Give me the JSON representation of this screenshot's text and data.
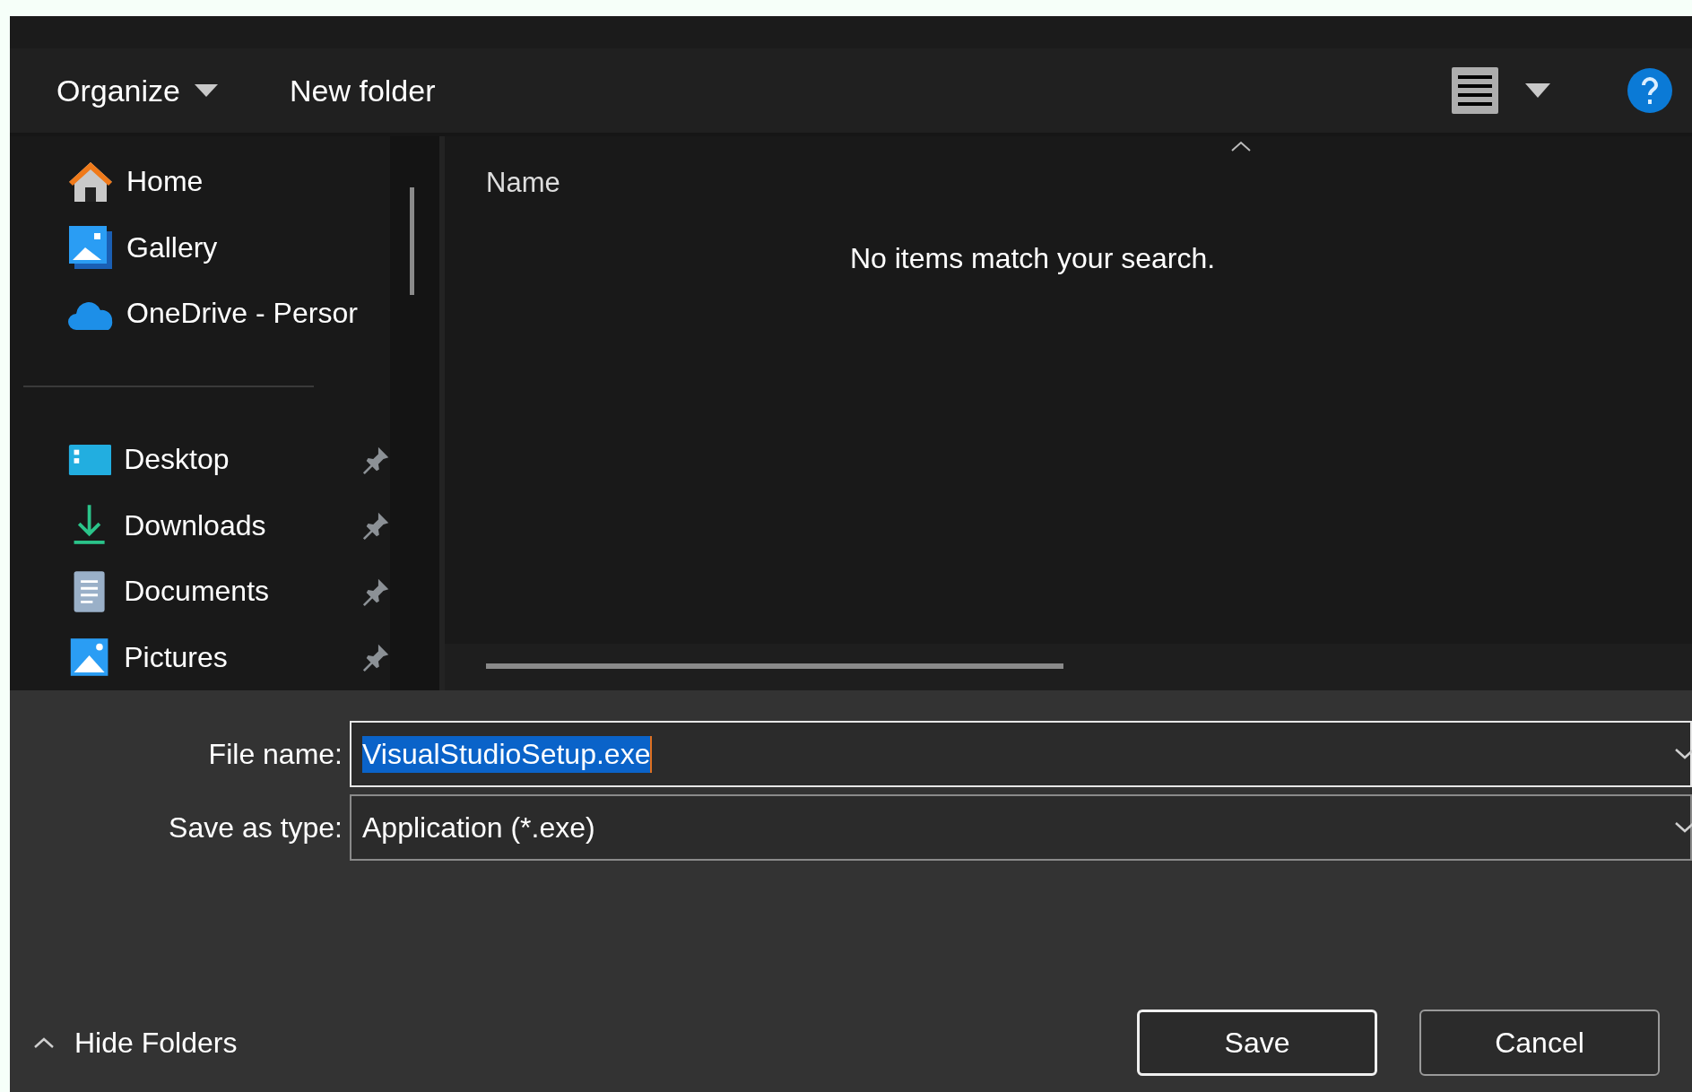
{
  "toolbar": {
    "organize": "Organize",
    "new_folder": "New folder"
  },
  "sidebar": {
    "items": [
      {
        "label": "Home",
        "kind": "home",
        "pinned": false,
        "selected": false
      },
      {
        "label": "Gallery",
        "kind": "gallery",
        "pinned": false,
        "selected": false
      },
      {
        "label": "OneDrive - Persor",
        "kind": "cloud",
        "pinned": false,
        "selected": false
      }
    ],
    "pinned_items": [
      {
        "label": "Desktop",
        "kind": "desktop",
        "pinned": true,
        "selected": false
      },
      {
        "label": "Downloads",
        "kind": "download",
        "pinned": true,
        "selected": false
      },
      {
        "label": "Documents",
        "kind": "document",
        "pinned": true,
        "selected": false
      },
      {
        "label": "Pictures",
        "kind": "picture",
        "pinned": true,
        "selected": false
      }
    ]
  },
  "file_list": {
    "columns": [
      "Name"
    ],
    "empty_message": "No items match your search."
  },
  "form": {
    "file_name": {
      "label": "File name:",
      "value": "VisualStudioSetup.exe",
      "selected": true
    },
    "save_as_type": {
      "label": "Save as type:",
      "value": "Application (*.exe)"
    }
  },
  "footer": {
    "hide_folders": "Hide Folders",
    "buttons": [
      {
        "label": "Save",
        "default": true
      },
      {
        "label": "Cancel",
        "default": false
      }
    ]
  }
}
